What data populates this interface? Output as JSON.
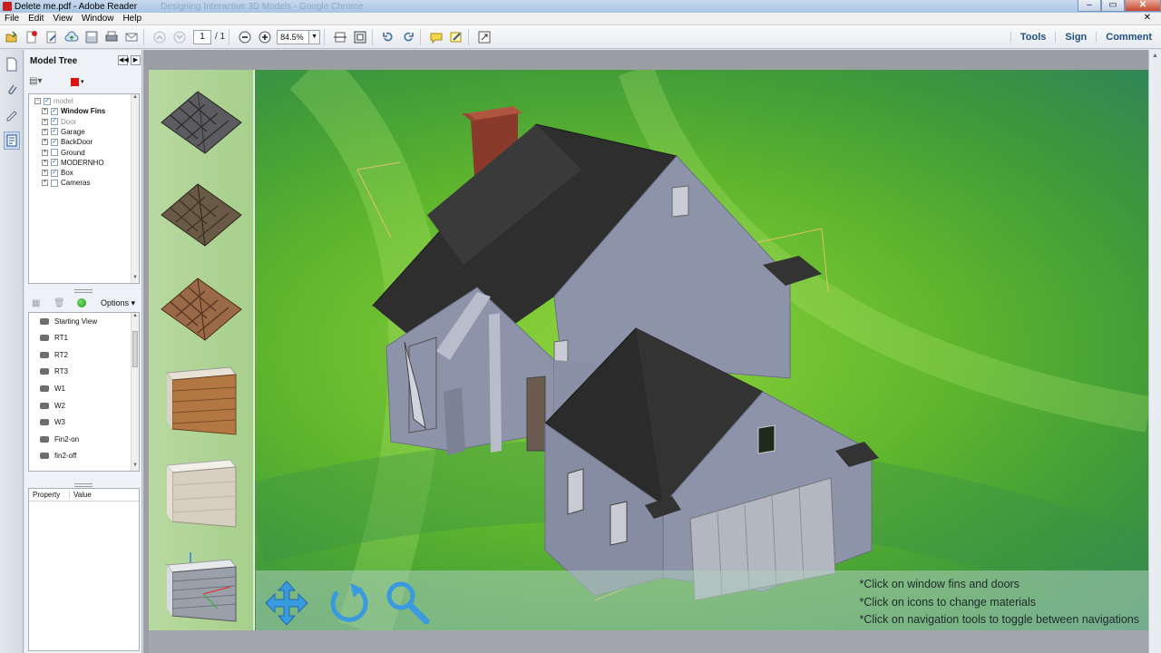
{
  "window": {
    "title": "Delete me.pdf - Adobe Reader",
    "background_title": "Designing Interactive 3D Models - Google Chrome",
    "controls": {
      "minimize": "–",
      "maximize": "▭",
      "close": "✕"
    }
  },
  "menu": {
    "items": [
      "File",
      "Edit",
      "View",
      "Window",
      "Help"
    ],
    "close": "✕"
  },
  "toolbar": {
    "page_current": "1",
    "page_total": "/ 1",
    "zoom": "84.5%",
    "links": [
      "Tools",
      "Sign",
      "Comment"
    ]
  },
  "model_tree": {
    "title": "Model Tree",
    "tree_items": [
      {
        "label": "model",
        "checked": true,
        "bold": false,
        "faded": true
      },
      {
        "label": "Window Fins",
        "checked": true,
        "bold": true,
        "faded": false
      },
      {
        "label": "Door",
        "checked": true,
        "bold": false,
        "faded": true
      },
      {
        "label": "Garage",
        "checked": true,
        "bold": false,
        "faded": false
      },
      {
        "label": "BackDoor",
        "checked": true,
        "bold": false,
        "faded": false
      },
      {
        "label": "Ground",
        "checked": false,
        "bold": false,
        "faded": false
      },
      {
        "label": "MODERNHO",
        "checked": true,
        "bold": false,
        "faded": false
      },
      {
        "label": "Box",
        "checked": true,
        "bold": false,
        "faded": false
      },
      {
        "label": "Cameras",
        "checked": false,
        "bold": false,
        "faded": false
      }
    ],
    "options_label": "Options",
    "views": [
      "Starting View",
      "RT1",
      "RT2",
      "RT3",
      "W1",
      "W2",
      "W3",
      "Fin2-on",
      "fin2-off"
    ],
    "property_header": "Property",
    "value_header": "Value"
  },
  "scene": {
    "instructions": [
      "*Click on window fins and doors",
      "*Click on icons to change materials",
      "*Click on navigation tools to toggle between navigations"
    ]
  },
  "colors": {
    "accent": "#1f4f8a",
    "nav_tool_blue": "#3a9ae0",
    "roof_dark": "#2e2e2e",
    "wall_gray": "#8d93a8",
    "chimney_brick": "#8a3a2a"
  }
}
